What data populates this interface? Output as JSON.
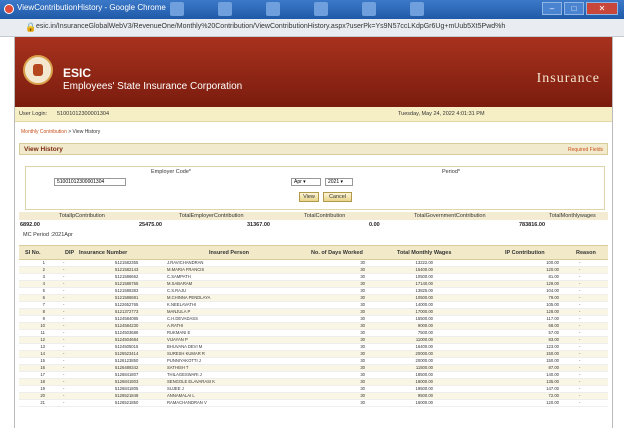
{
  "browser": {
    "title": "ViewContributionHistory - Google Chrome",
    "url": "esic.in/InsuranceGlobalWebV3/RevenueOne/Monthly%20Contribution/ViewContributionHistory.aspx?userPk=Ys9N57ccLKdpGr6Ug+mUub5Xt5Pwd%h"
  },
  "header": {
    "abbr": "ESIC",
    "name": "Employees' State Insurance Corporation",
    "section": "Insurance"
  },
  "userbar": {
    "label": "User Login:",
    "code": "51001012300001304",
    "datetime": "Tuesday, May 24, 2022 4:01:31 PM"
  },
  "breadcrumb": {
    "link": "Monthly Contribution",
    "current": " > View History"
  },
  "panel": {
    "title": "View History",
    "required": "Required Fields"
  },
  "form": {
    "employer_label": "Employer Code*",
    "employer_value": "51001012300001304",
    "period_label": "Period*",
    "month": "Apr",
    "year": "2021",
    "view_label": "View",
    "cancel_label": "Cancel"
  },
  "totals": {
    "headers": [
      "TotalIpContribution",
      "TotalEmployerContribution",
      "TotalContribution",
      "TotalGovernmentContribution",
      "TotalMonthlywages"
    ],
    "values": [
      "6892.00",
      "25475.00",
      "31367.00",
      "0.00",
      "783816.00"
    ]
  },
  "period_text": "MC Period :2021Apr",
  "table": {
    "headers": [
      "SI No.",
      "DIP",
      "Insurance Number",
      "Insured Person",
      "No. of Days Worked",
      "Total Monthly Wages",
      "IP Contribution",
      "Reason"
    ],
    "rows": [
      [
        "1",
        "-",
        "5121582355",
        "J.RAVICHANDRAN",
        "30",
        "13222.00",
        "100.00",
        "-"
      ],
      [
        "2",
        "-",
        "5121582143",
        "M.MARIA FRANCIS",
        "30",
        "15400.00",
        "120.00",
        "-"
      ],
      [
        "3",
        "-",
        "5121586662",
        "C.SAMPATH",
        "30",
        "10500.00",
        "81.00",
        "-"
      ],
      [
        "4",
        "-",
        "5121586755",
        "M.SABARAM",
        "30",
        "17140.00",
        "129.00",
        "-"
      ],
      [
        "5",
        "-",
        "5121586383",
        "C.S.RAJU",
        "30",
        "13825.00",
        "104.00",
        "-"
      ],
      [
        "6",
        "-",
        "5121586681",
        "M.CHINNA PENDLAYA",
        "30",
        "10500.00",
        "79.00",
        "-"
      ],
      [
        "7",
        "-",
        "5122652765",
        "K.NEELAVATHI",
        "30",
        "14000.00",
        "105.00",
        "-"
      ],
      [
        "8",
        "-",
        "5121372773",
        "MANJULA P",
        "30",
        "17000.00",
        "128.00",
        "-"
      ],
      [
        "9",
        "-",
        "5124584085",
        "C.H.DEVADASS",
        "30",
        "15500.00",
        "117.00",
        "-"
      ],
      [
        "10",
        "-",
        "5124584230",
        "A.RATHI",
        "30",
        "9000.00",
        "68.00",
        "-"
      ],
      [
        "11",
        "-",
        "5124503686",
        "RUKMANI E",
        "30",
        "7500.00",
        "57.00",
        "-"
      ],
      [
        "12",
        "-",
        "5124504684",
        "VIJAYAN P",
        "30",
        "11000.00",
        "83.00",
        "-"
      ],
      [
        "13",
        "-",
        "5124505015",
        "BHUVANA DEVI M",
        "30",
        "16400.00",
        "123.00",
        "-"
      ],
      [
        "14",
        "-",
        "5126523414",
        "SURESH KUMAR R",
        "30",
        "20000.00",
        "150.00",
        "-"
      ],
      [
        "15",
        "-",
        "5126123850",
        "PUNNIYAKOTTI J",
        "30",
        "20000.00",
        "150.00",
        "-"
      ],
      [
        "16",
        "-",
        "5126489342",
        "SATHISH T",
        "30",
        "11500.00",
        "87.00",
        "-"
      ],
      [
        "17",
        "-",
        "5126841807",
        "THILAGESWARI J",
        "30",
        "18500.00",
        "140.00",
        "-"
      ],
      [
        "18",
        "-",
        "5126841803",
        "SENGOLE ELAVARASI K",
        "30",
        "18000.00",
        "135.00",
        "-"
      ],
      [
        "19",
        "-",
        "5126841805",
        "SUJEE J",
        "30",
        "19500.00",
        "147.00",
        "-"
      ],
      [
        "20",
        "-",
        "5126521848",
        "ANNAMALAI L",
        "30",
        "9500.00",
        "72.00",
        "-"
      ],
      [
        "21",
        "-",
        "5126521850",
        "RAMACHANDRAN V",
        "30",
        "16000.00",
        "120.00",
        "-"
      ]
    ]
  }
}
